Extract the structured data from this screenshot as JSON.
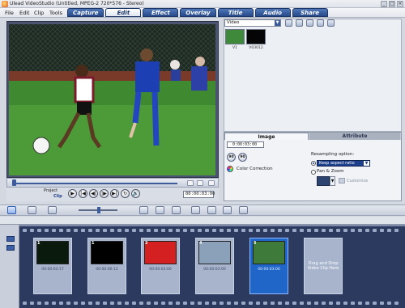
{
  "window": {
    "title": "Ulead VideoStudio (Untitled, MPEG-2 720*576 - Stereo)",
    "controls": [
      "_",
      "□",
      "×"
    ]
  },
  "menu": {
    "items": [
      "File",
      "Edit",
      "Clip",
      "Tools"
    ]
  },
  "steps": {
    "items": [
      "Capture",
      "Edit",
      "Effect",
      "Overlay",
      "Title",
      "Audio",
      "Share"
    ],
    "active": "Edit"
  },
  "preview": {
    "project_label": "Project",
    "clip_label": "Clip",
    "playback_buttons": [
      "▶",
      "|◀",
      "◀|",
      "|▶",
      "▶|",
      "↻",
      "🔊"
    ],
    "timecode": "00:00:03:00"
  },
  "library": {
    "category": "Video",
    "thumbnails": [
      {
        "label": "V1",
        "color": "#3e8a3a"
      },
      {
        "label": "V03012",
        "color": "#050505"
      }
    ]
  },
  "options": {
    "tabs": [
      "Image",
      "Attribute"
    ],
    "active_tab": "Image",
    "duration": "0:00:03:00",
    "rotate_left": "90",
    "rotate_right": "90",
    "color_correction": "Color Correction",
    "resampling_label": "Resampling option:",
    "resampling_value": "Keep aspect ratio",
    "pan_zoom": "Pan & Zoom",
    "customize": "Customize"
  },
  "storyboard": {
    "clips": [
      {
        "num": "1",
        "duration": "00:00:03:17",
        "color": "#0a1a0c",
        "selected": false
      },
      {
        "num": "1",
        "duration": "00:00:06:12",
        "color": "#000000",
        "selected": false
      },
      {
        "num": "3",
        "duration": "00:00:03:00",
        "color": "#d42020",
        "selected": false
      },
      {
        "num": "4",
        "duration": "00:00:03:00",
        "color": "#8aa1b9",
        "selected": false
      },
      {
        "num": "5",
        "duration": "00:00:03:00",
        "color": "#3e7a3a",
        "selected": true
      }
    ],
    "drop_hint": "Drag and Drop Video Clip Here"
  }
}
